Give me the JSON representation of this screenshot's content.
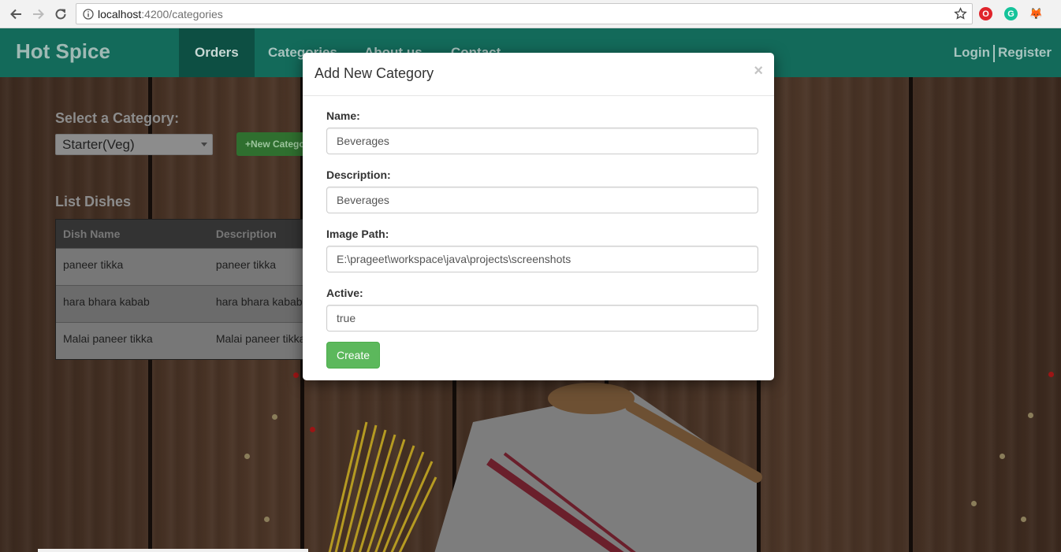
{
  "browser": {
    "url_host": "localhost",
    "url_path": ":4200/categories"
  },
  "navbar": {
    "brand": "Hot Spice",
    "items": [
      {
        "label": "Orders",
        "active": true
      },
      {
        "label": "Categories",
        "active": false
      },
      {
        "label": "About us",
        "active": false
      },
      {
        "label": "Contact",
        "active": false
      }
    ],
    "login": "Login",
    "register": "Register",
    "color": "#136a5a"
  },
  "content": {
    "select_label": "Select a Category:",
    "selected_category": "Starter(Veg)",
    "new_category_button": "+New Category",
    "list_title": "List Dishes",
    "table": {
      "headers": [
        "Dish Name",
        "Description"
      ],
      "rows": [
        [
          "paneer tikka",
          "paneer tikka"
        ],
        [
          "hara bhara kabab",
          "hara bhara kabab"
        ],
        [
          "Malai paneer tikka",
          "Malai paneer tikka"
        ]
      ]
    }
  },
  "modal": {
    "title": "Add New Category",
    "close": "×",
    "fields": [
      {
        "label": "Name:",
        "value": "Beverages"
      },
      {
        "label": "Description:",
        "value": "Beverages"
      },
      {
        "label": "Image Path:",
        "value": "E:\\prageet\\workspace\\java\\projects\\screenshots"
      },
      {
        "label": "Active:",
        "value": "true"
      }
    ],
    "submit": "Create",
    "submit_color": "#5cb85c"
  }
}
